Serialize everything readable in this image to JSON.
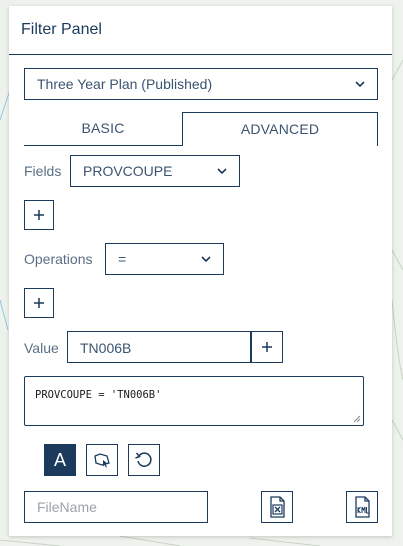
{
  "panel": {
    "title": "Filter Panel"
  },
  "layer_select": {
    "value": "Three Year Plan (Published)"
  },
  "tabs": [
    {
      "label": "BASIC"
    },
    {
      "label": "ADVANCED"
    }
  ],
  "fields": {
    "label": "Fields",
    "value": "PROVCOUPE"
  },
  "operations": {
    "label": "Operations",
    "value": "="
  },
  "value": {
    "label": "Value",
    "input": "TN006B"
  },
  "expression": "PROVCOUPE = 'TN006B'",
  "tools": {
    "text_mode_label": "A"
  },
  "filename": {
    "placeholder": "FileName"
  },
  "colors": {
    "primary": "#1b3a5c",
    "background_map": "#eef2ec",
    "accent_line": "#3aa0d8"
  },
  "icons": [
    "chevron-down-icon",
    "plus-icon",
    "map-select-icon",
    "reset-icon",
    "export-excel-icon",
    "export-kml-icon"
  ]
}
